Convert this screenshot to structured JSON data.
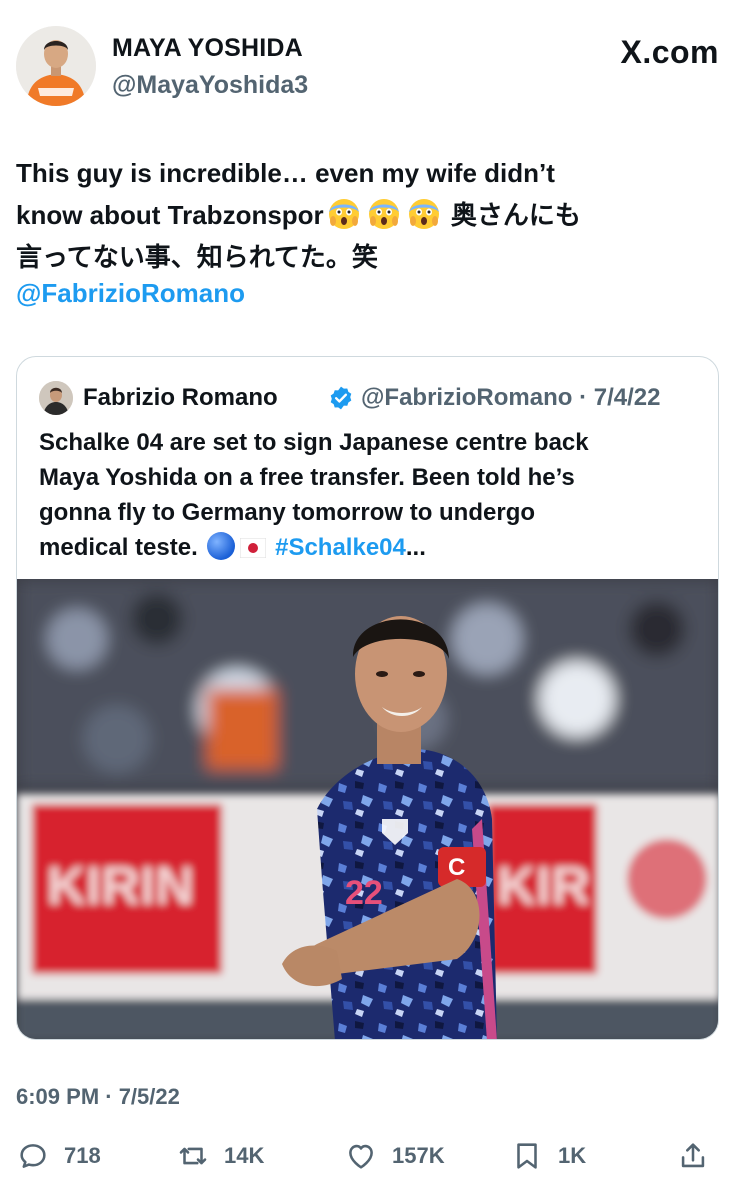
{
  "author": {
    "name": "MAYA YOSHIDA",
    "handle": "@MayaYoshida3"
  },
  "brand": "X.com",
  "tweet": {
    "line1": "This guy is incredible… even my wife didn’t",
    "line2_pre": "know about Trabzonspor",
    "line2_post": "奥さんにも",
    "line3": "言ってない事、知られてた。笑",
    "mention": "@FabrizioRomano",
    "emoji": "face-screaming-in-fear"
  },
  "quote": {
    "name": "Fabrizio Romano",
    "handle": "@FabrizioRomano · 7/4/22",
    "line1": "Schalke 04 are set to sign Japanese centre back",
    "line2": "Maya Yoshida on a free transfer. Been told he’s",
    "line3": "gonna fly to Germany tomorrow to undergo",
    "line4_pre": "medical teste.",
    "hashtag": "#Schalke04",
    "ellipsis": "..."
  },
  "timestamp": "6:09 PM · 7/5/22",
  "actions": {
    "replies": "718",
    "reposts": "14K",
    "likes": "157K",
    "bookmarks": "1K"
  },
  "colors": {
    "accent": "#1d9bf0",
    "muted": "#536471",
    "text": "#0f1419",
    "border": "#cfd9de"
  },
  "icons": [
    "reply-icon",
    "repost-icon",
    "like-icon",
    "bookmark-icon",
    "share-icon",
    "verified-badge-icon"
  ]
}
